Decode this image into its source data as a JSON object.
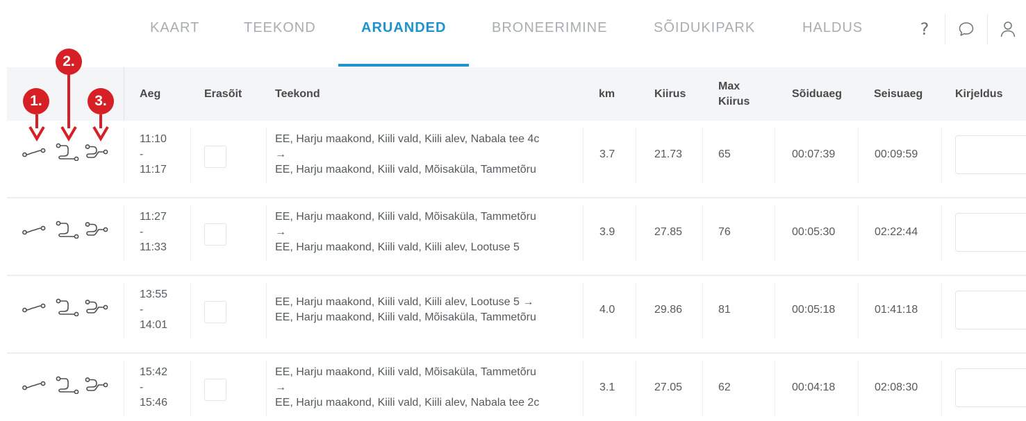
{
  "nav": {
    "tabs": [
      {
        "label": "KAART",
        "active": false
      },
      {
        "label": "TEEKOND",
        "active": false
      },
      {
        "label": "ARUANDED",
        "active": true
      },
      {
        "label": "BRONEERIMINE",
        "active": false
      },
      {
        "label": "SÕIDUKIPARK",
        "active": false
      },
      {
        "label": "HALDUS",
        "active": false
      }
    ],
    "icons": [
      "help-icon",
      "chat-icon",
      "user-icon"
    ],
    "help_glyph": "?"
  },
  "annotations": {
    "markers": [
      "1.",
      "2.",
      "3."
    ],
    "color": "#d71f26"
  },
  "table": {
    "headers": {
      "time": "Aeg",
      "private": "Erasõit",
      "route": "Teekond",
      "km": "km",
      "speed": "Kiirus",
      "max_speed_1": "Max",
      "max_speed_2": "Kiirus",
      "drive_time": "Sõiduaeg",
      "idle_time": "Seisuaeg",
      "description": "Kirjeldus"
    },
    "rows": [
      {
        "start": "11:10",
        "dash": "-",
        "end": "11:17",
        "route": [
          "EE, Harju maakond, Kiili vald, Kiili alev, Nabala tee 4c",
          "→",
          "EE, Harju maakond, Kiili vald, Mõisaküla, Tammetõru"
        ],
        "km": "3.7",
        "speed": "21.73",
        "max_speed": "65",
        "drive_time": "00:07:39",
        "idle_time": "00:09:59"
      },
      {
        "start": "11:27",
        "dash": "-",
        "end": "11:33",
        "route": [
          "EE, Harju maakond, Kiili vald, Mõisaküla, Tammetõru",
          "→",
          "EE, Harju maakond, Kiili vald, Kiili alev, Lootuse 5"
        ],
        "km": "3.9",
        "speed": "27.85",
        "max_speed": "76",
        "drive_time": "00:05:30",
        "idle_time": "02:22:44"
      },
      {
        "start": "13:55",
        "dash": "-",
        "end": "14:01",
        "route": [
          "EE, Harju maakond, Kiili vald, Kiili alev, Lootuse 5 →",
          "EE, Harju maakond, Kiili vald, Mõisaküla, Tammetõru"
        ],
        "km": "4.0",
        "speed": "29.86",
        "max_speed": "81",
        "drive_time": "00:05:18",
        "idle_time": "01:41:18"
      },
      {
        "start": "15:42",
        "dash": "-",
        "end": "15:46",
        "route": [
          "EE, Harju maakond, Kiili vald, Mõisaküla, Tammetõru",
          "→",
          "EE, Harju maakond, Kiili vald, Kiili alev, Nabala tee 2c"
        ],
        "km": "3.1",
        "speed": "27.05",
        "max_speed": "62",
        "drive_time": "00:04:18",
        "idle_time": "02:08:30"
      }
    ]
  },
  "colors": {
    "accent": "#1e93cf",
    "inactive_tab": "#a9adb1",
    "header_bg": "#f4f5f7"
  }
}
